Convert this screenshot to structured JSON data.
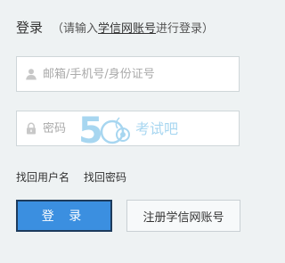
{
  "header": {
    "title": "登录",
    "hint_prefix": "（请输入",
    "hint_link": "学信网账号",
    "hint_suffix": "进行登录）"
  },
  "form": {
    "username": {
      "placeholder": "邮箱/手机号/身份证号",
      "value": "",
      "icon": "user-icon"
    },
    "password": {
      "placeholder": "密码",
      "value": "",
      "icon": "lock-icon"
    }
  },
  "links": {
    "find_username": "找回用户名",
    "find_password": "找回密码"
  },
  "buttons": {
    "login": "登 录",
    "register": "注册学信网账号"
  },
  "watermark": {
    "number": "5",
    "text": "考试吧"
  },
  "colors": {
    "background": "#eef2f3",
    "primary": "#3b8fe0",
    "primary_border": "#1d3b5c",
    "watermark": "#3da5e0"
  }
}
